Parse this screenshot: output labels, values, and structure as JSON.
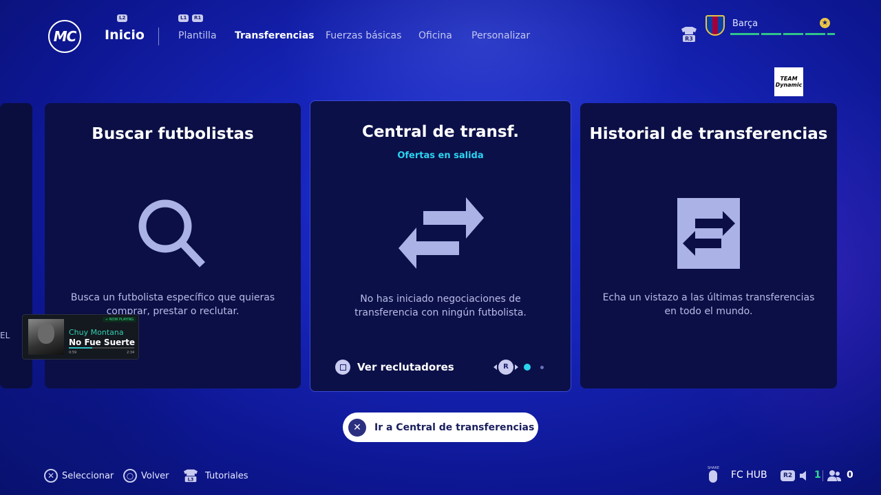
{
  "header": {
    "logo_text": "MC",
    "home_label": "Inicio",
    "hint_l2": "L2",
    "hint_l1": "L1",
    "hint_r1": "R1",
    "tabs": [
      {
        "label": "Plantilla",
        "active": false
      },
      {
        "label": "Transferencias",
        "active": true
      },
      {
        "label": "Fuerzas básicas",
        "active": false
      },
      {
        "label": "Oficina",
        "active": false
      },
      {
        "label": "Personalizar",
        "active": false
      }
    ],
    "r3_hint": "R3",
    "club_name": "Barça",
    "club_star": "★",
    "team_tag": "TEAM Dynamic"
  },
  "cards": {
    "partial_label": "EL",
    "search": {
      "title": "Buscar futbolistas",
      "description": "Busca un futbolista específico que quieras comprar, prestar o reclutar.",
      "icon": "magnifier-icon"
    },
    "transfer_hub": {
      "title": "Central de transf.",
      "subtitle": "Ofertas en salida",
      "description": "No has iniciado negociaciones de transferencia con ningún futbolista.",
      "icon": "transfer-arrows-icon",
      "secondary_action": "Ver reclutadores",
      "pager_hint": "R",
      "page_index": 1,
      "page_count": 2
    },
    "history": {
      "title": "Historial de transferencias",
      "description": "Echa un vistazo a las últimas transferencias en todo el mundo.",
      "icon": "transfer-history-icon"
    }
  },
  "now_playing": {
    "tag": "≈ NOW PLAYING",
    "artist": "Chuy Montana",
    "song": "No Fue Suerte",
    "elapsed": "0:59",
    "duration": "2:34",
    "progress": 0.36
  },
  "primary_action": {
    "label": "Ir a Central de transferencias"
  },
  "footer": {
    "select": "Seleccionar",
    "back": "Volver",
    "tutorials": "Tutoriales",
    "l3_hint": "L3",
    "share_label": "SHARE",
    "fc_hub": "FC HUB",
    "r2_hint": "R2",
    "notifications": "1",
    "friends": "0"
  },
  "colors": {
    "accent_cyan": "#2ad4f0",
    "active_green": "#30c48a",
    "card_bg": "#0b0f45",
    "icon_lavender": "#aab2e6"
  }
}
